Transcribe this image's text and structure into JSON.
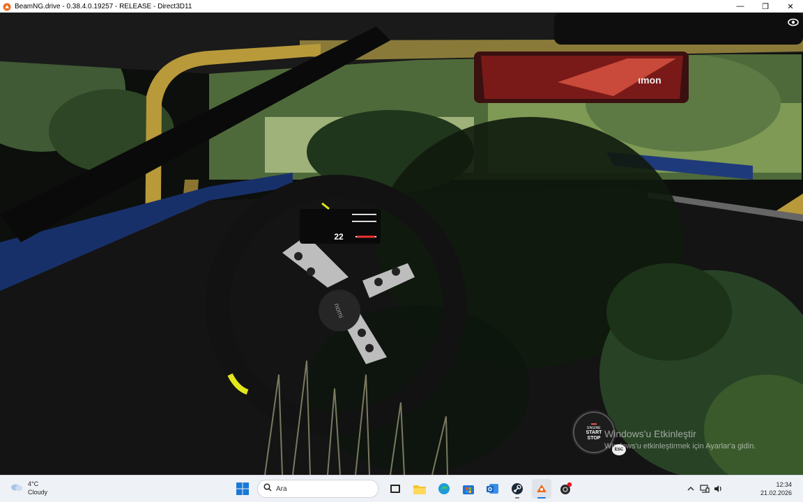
{
  "window": {
    "title": "BeamNG.drive - 0.38.4.0.19257 - RELEASE - Direct3D11",
    "controls": [
      "—",
      "❐",
      "✕"
    ]
  },
  "game": {
    "dash_display_speed": "22",
    "steering_wheel_brand": "nomi",
    "mirror_brand": "ımon",
    "engine_button": {
      "line1": "ENGINE",
      "line2": "START",
      "line3": "STOP"
    },
    "esc_label": "ESC"
  },
  "watermark": {
    "title": "Windows'u Etkinleştir",
    "subtitle": "Windows'u etkinleştirmek için Ayarlar'a gidin."
  },
  "taskbar": {
    "weather": {
      "temp": "4°C",
      "condition": "Cloudy"
    },
    "search_placeholder": "Ara",
    "clock": {
      "time": "12:34",
      "date": "21.02.2026"
    }
  }
}
